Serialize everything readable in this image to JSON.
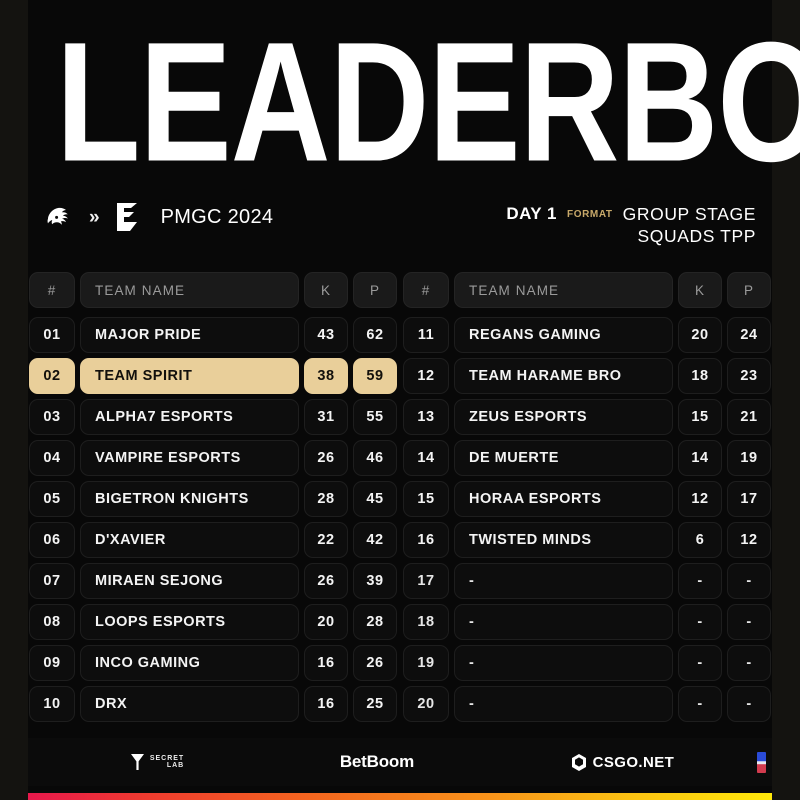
{
  "page": {
    "title": "LEADERBOARD",
    "accent_gold": "#e9cf9a",
    "background": "#080808"
  },
  "header": {
    "team_logo_icon": "dragon-head-icon",
    "separator_icon": "double-chevron-right-icon",
    "event_logo_icon": "esports-e-logo-icon",
    "event_name": "PMGC 2024",
    "day_label": "DAY 1",
    "format_label": "FORMAT",
    "format_line1": "GROUP STAGE",
    "format_line2": "SQUADS TPP"
  },
  "table": {
    "columns": {
      "rank": "#",
      "team": "TEAM NAME",
      "kills": "K",
      "points": "P"
    },
    "left_rows": [
      {
        "rank": "01",
        "team": "MAJOR PRIDE",
        "k": "43",
        "p": "62",
        "highlight": false
      },
      {
        "rank": "02",
        "team": "TEAM SPIRIT",
        "k": "38",
        "p": "59",
        "highlight": true
      },
      {
        "rank": "03",
        "team": "ALPHA7 ESPORTS",
        "k": "31",
        "p": "55",
        "highlight": false
      },
      {
        "rank": "04",
        "team": "VAMPIRE ESPORTS",
        "k": "26",
        "p": "46",
        "highlight": false
      },
      {
        "rank": "05",
        "team": "BIGETRON KNIGHTS",
        "k": "28",
        "p": "45",
        "highlight": false
      },
      {
        "rank": "06",
        "team": "D'XAVIER",
        "k": "22",
        "p": "42",
        "highlight": false
      },
      {
        "rank": "07",
        "team": "MIRAEN SEJONG",
        "k": "26",
        "p": "39",
        "highlight": false
      },
      {
        "rank": "08",
        "team": "LOOPS ESPORTS",
        "k": "20",
        "p": "28",
        "highlight": false
      },
      {
        "rank": "09",
        "team": "INCO GAMING",
        "k": "16",
        "p": "26",
        "highlight": false
      },
      {
        "rank": "10",
        "team": "DRX",
        "k": "16",
        "p": "25",
        "highlight": false
      }
    ],
    "right_rows": [
      {
        "rank": "11",
        "team": "REGANS GAMING",
        "k": "20",
        "p": "24",
        "highlight": false
      },
      {
        "rank": "12",
        "team": "TEAM HARAME BRO",
        "k": "18",
        "p": "23",
        "highlight": false
      },
      {
        "rank": "13",
        "team": "ZEUS ESPORTS",
        "k": "15",
        "p": "21",
        "highlight": false
      },
      {
        "rank": "14",
        "team": "DE MUERTE",
        "k": "14",
        "p": "19",
        "highlight": false
      },
      {
        "rank": "15",
        "team": "HORAA ESPORTS",
        "k": "12",
        "p": "17",
        "highlight": false
      },
      {
        "rank": "16",
        "team": "TWISTED MINDS",
        "k": "6",
        "p": "12",
        "highlight": false
      },
      {
        "rank": "17",
        "team": "-",
        "k": "-",
        "p": "-",
        "highlight": false
      },
      {
        "rank": "18",
        "team": "-",
        "k": "-",
        "p": "-",
        "highlight": false
      },
      {
        "rank": "19",
        "team": "-",
        "k": "-",
        "p": "-",
        "highlight": false
      },
      {
        "rank": "20",
        "team": "-",
        "k": "-",
        "p": "-",
        "highlight": false
      }
    ]
  },
  "footer": {
    "sponsors": [
      {
        "name_line1": "SECRET",
        "name_line2": "LAB",
        "icon": "secretlab-triangle-icon"
      },
      {
        "name": "BetBoom"
      },
      {
        "name": "CSGO.NET",
        "icon": "hexagon-icon"
      }
    ],
    "edge_logo_icon": "partial-sponsor-logo-icon"
  }
}
